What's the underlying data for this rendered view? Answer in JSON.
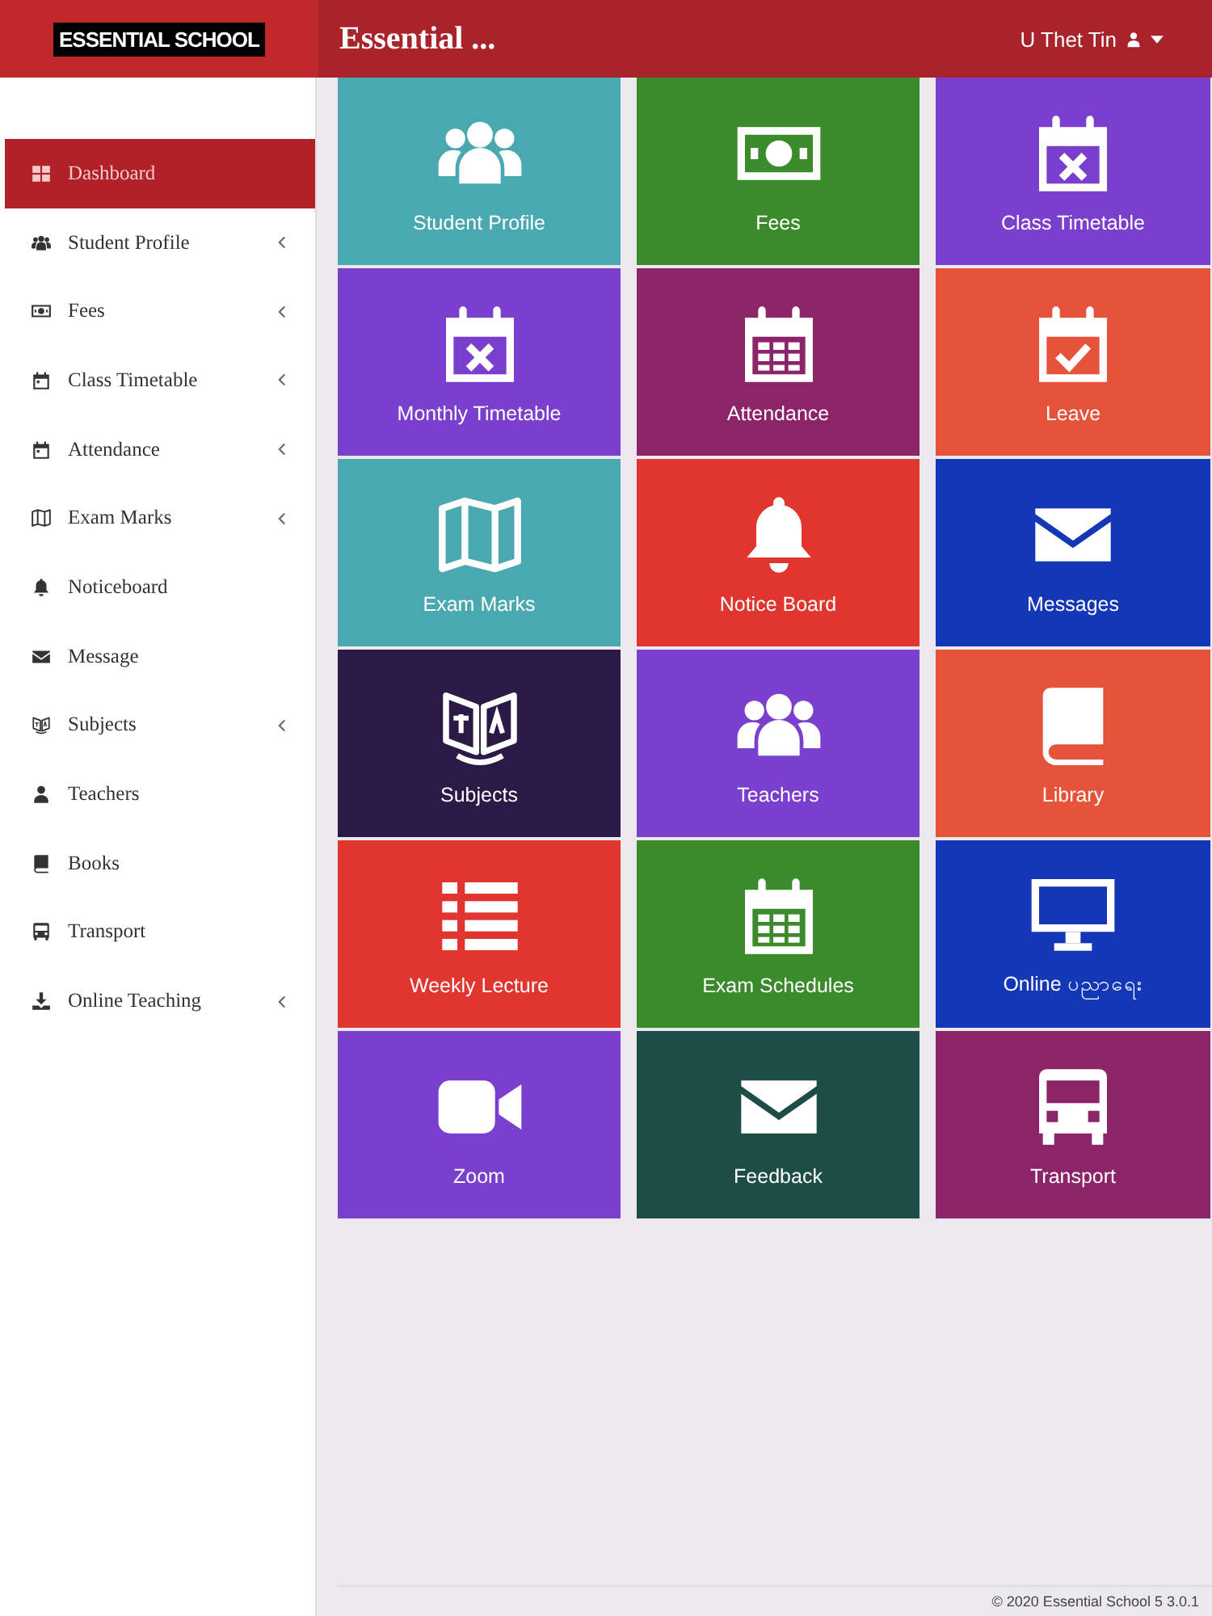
{
  "header": {
    "logo": "ESSENTIAL SCHOOL",
    "title": "Essential ...",
    "user": "U Thet Tin"
  },
  "sidebar": {
    "items": [
      {
        "label": "Dashboard",
        "kind": "grid",
        "has_submenu": false,
        "selected": true
      },
      {
        "label": "Student Profile",
        "kind": "people",
        "has_submenu": true,
        "selected": false
      },
      {
        "label": "Fees",
        "kind": "money",
        "has_submenu": true,
        "selected": false
      },
      {
        "label": "Class Timetable",
        "kind": "calendar",
        "has_submenu": true,
        "selected": false
      },
      {
        "label": "Attendance",
        "kind": "calendar",
        "has_submenu": true,
        "selected": false
      },
      {
        "label": "Exam Marks",
        "kind": "map",
        "has_submenu": true,
        "selected": false
      },
      {
        "label": "Noticeboard",
        "kind": "bell",
        "has_submenu": false,
        "selected": false
      },
      {
        "label": "Message",
        "kind": "envelope",
        "has_submenu": false,
        "selected": false
      },
      {
        "label": "Subjects",
        "kind": "translate",
        "has_submenu": true,
        "selected": false
      },
      {
        "label": "Teachers",
        "kind": "person",
        "has_submenu": false,
        "selected": false
      },
      {
        "label": "Books",
        "kind": "book",
        "has_submenu": false,
        "selected": false
      },
      {
        "label": "Transport",
        "kind": "bus",
        "has_submenu": false,
        "selected": false
      },
      {
        "label": "Online Teaching",
        "kind": "download",
        "has_submenu": true,
        "selected": false
      }
    ]
  },
  "tiles": [
    {
      "label": "Student Profile",
      "kind": "people",
      "color": "#4aa9b0"
    },
    {
      "label": "Fees",
      "kind": "money",
      "color": "#3b8a2b"
    },
    {
      "label": "Class Timetable",
      "kind": "calendar-x",
      "color": "#7b3fce"
    },
    {
      "label": "Monthly Timetable",
      "kind": "calendar-x",
      "color": "#7b3fce"
    },
    {
      "label": "Attendance",
      "kind": "calendar-grid",
      "color": "#8c2469"
    },
    {
      "label": "Leave",
      "kind": "calendar-check",
      "color": "#e5533a"
    },
    {
      "label": "Exam Marks",
      "kind": "map",
      "color": "#4aa9b0"
    },
    {
      "label": "Notice Board",
      "kind": "bell",
      "color": "#e0362f"
    },
    {
      "label": "Messages",
      "kind": "envelope",
      "color": "#1437b7"
    },
    {
      "label": "Subjects",
      "kind": "translate",
      "color": "#2a1a45"
    },
    {
      "label": "Teachers",
      "kind": "people",
      "color": "#7b3fce"
    },
    {
      "label": "Library",
      "kind": "book",
      "color": "#e5533a"
    },
    {
      "label": "Weekly Lecture",
      "kind": "list",
      "color": "#e0362f"
    },
    {
      "label": "Exam Schedules",
      "kind": "calendar-grid",
      "color": "#3b8a2b"
    },
    {
      "label": "Online ပညာရေး",
      "kind": "monitor",
      "color": "#1437b7"
    },
    {
      "label": "Zoom",
      "kind": "video",
      "color": "#7b3fce"
    },
    {
      "label": "Feedback",
      "kind": "envelope",
      "color": "#1e4d47"
    },
    {
      "label": "Transport",
      "kind": "bus",
      "color": "#8c2469"
    }
  ],
  "footer": {
    "text": "© 2020 Essential School 5 3.0.1"
  }
}
